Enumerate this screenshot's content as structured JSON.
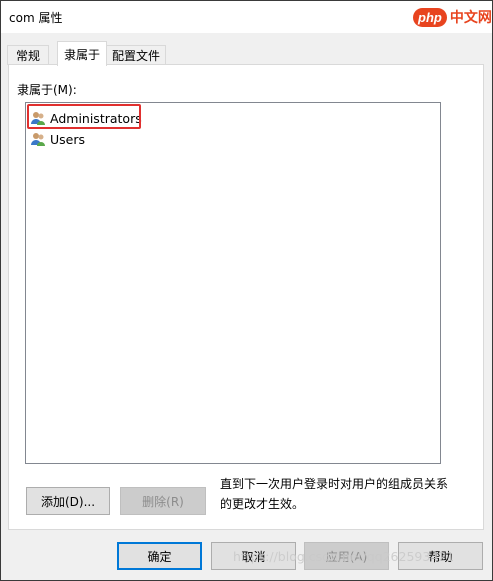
{
  "window": {
    "title": "com 属性"
  },
  "watermark_top": {
    "badge": "php",
    "text": "中文网"
  },
  "tabs": [
    {
      "label": "常规"
    },
    {
      "label": "隶属于"
    },
    {
      "label": "配置文件"
    }
  ],
  "member_of_label": "隶属于(M):",
  "groups": [
    {
      "name": "Administrators",
      "icon": "user-group-icon"
    },
    {
      "name": "Users",
      "icon": "user-group-icon"
    }
  ],
  "buttons": {
    "add": "添加(D)...",
    "remove": "删除(R)",
    "ok": "确定",
    "cancel": "取消",
    "apply": "应用(A)",
    "help": "帮助"
  },
  "note": "直到下一次用户登录时对用户的组成员关系的更改才生效。",
  "watermark_bottom": "https://blog.csdn.net/qq262593421"
}
